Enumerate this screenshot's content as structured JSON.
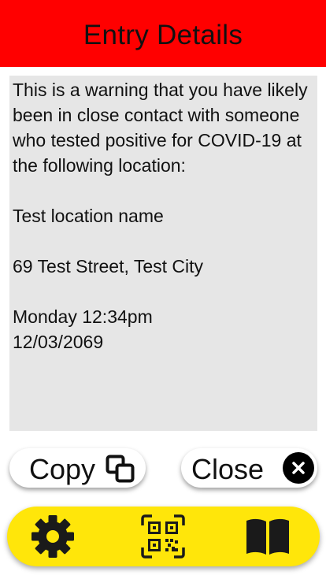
{
  "header": {
    "title": "Entry Details"
  },
  "message": {
    "text": "This is a warning that you have likely been in close contact with someone who tested positive for COVID-19 at the following location:\n\nTest location name\n\n69 Test Street, Test City\n\nMonday 12:34pm\n12/03/2069"
  },
  "actions": {
    "copy_label": "Copy",
    "copy_icon": "copy-icon",
    "close_label": "Close",
    "close_icon": "close-icon"
  },
  "bottom_nav": {
    "items": [
      {
        "icon": "gear-icon"
      },
      {
        "icon": "qr-code-icon"
      },
      {
        "icon": "book-icon"
      }
    ]
  },
  "colors": {
    "header_bg": "#ff0000",
    "message_bg": "#e6e6e6",
    "nav_bg": "#ffe60a",
    "nav_icon": "#1a1a1a"
  }
}
